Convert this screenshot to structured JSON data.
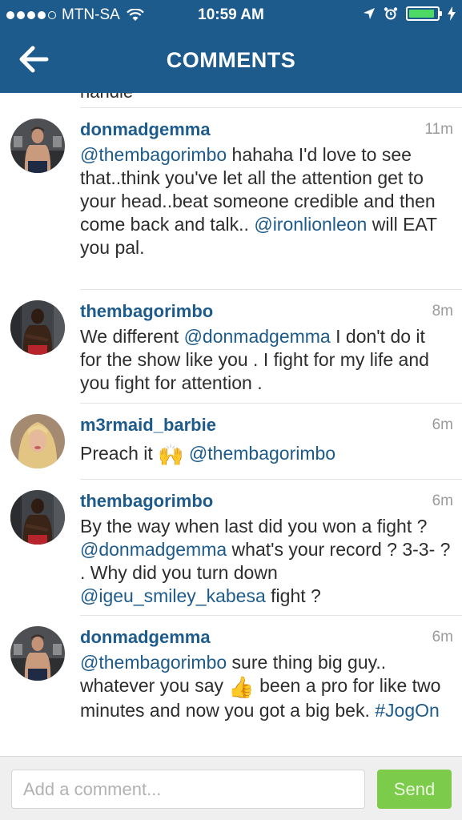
{
  "status_bar": {
    "signal_dots": 5,
    "signal_filled": 4,
    "carrier": "MTN-SA",
    "time": "10:59 AM",
    "battery_level": 0.9,
    "battery_color": "#4cd964"
  },
  "header": {
    "title": "COMMENTS",
    "back_icon": "arrow-left-icon",
    "bg_color": "#1d5b8c"
  },
  "clipped_comment_tail": "handle",
  "comments": [
    {
      "username": "donmadgemma",
      "time": "11m",
      "parts": [
        {
          "mention": "@thembagorimbo"
        },
        {
          "text": " hahaha I'd love to see that..think you've let all the attention get to your head..beat someone credible and then come back and talk.. "
        },
        {
          "mention": "@ironlionleon"
        },
        {
          "text": " will EAT you pal."
        }
      ]
    },
    {
      "username": "thembagorimbo",
      "time": "8m",
      "parts": [
        {
          "text": "We different "
        },
        {
          "mention": "@donmadgemma"
        },
        {
          "text": "  I don't do it for the show like you . I fight for my life and you fight for attention ."
        }
      ]
    },
    {
      "username": "m3rmaid_barbie",
      "time": "6m",
      "parts": [
        {
          "text": "Preach it "
        },
        {
          "emoji": "🙌"
        },
        {
          "text": " "
        },
        {
          "mention": "@thembagorimbo"
        }
      ]
    },
    {
      "username": "thembagorimbo",
      "time": "6m",
      "parts": [
        {
          "text": "By the way when last did you won a fight ? "
        },
        {
          "mention": "@donmadgemma"
        },
        {
          "text": "  what's your record ? 3-3- ? . Why did you turn down "
        },
        {
          "mention": "@igeu_smiley_kabesa"
        },
        {
          "text": "  fight ?"
        }
      ]
    },
    {
      "username": "donmadgemma",
      "time": "6m",
      "parts": [
        {
          "mention": "@thembagorimbo"
        },
        {
          "text": " sure thing big guy.. whatever you say "
        },
        {
          "emoji": "👍"
        },
        {
          "text": " been a pro for like two minutes and now you got a big bek. "
        },
        {
          "mention": "#JogOn"
        }
      ]
    }
  ],
  "composer": {
    "placeholder": "Add a comment...",
    "send_label": "Send",
    "send_color": "#7ccb4a"
  }
}
